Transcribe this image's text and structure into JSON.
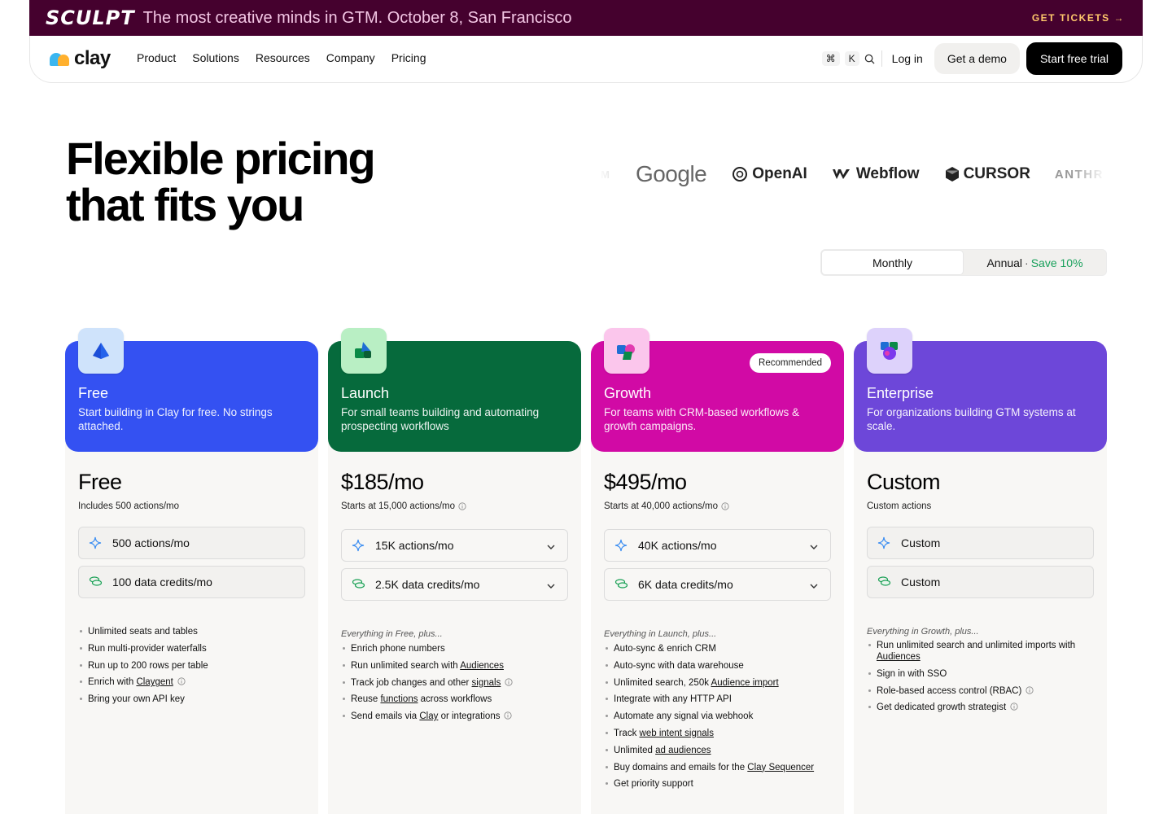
{
  "banner": {
    "brand": "SCULPT",
    "text": "The most creative minds in GTM. October 8, San Francisco",
    "cta": "GET TICKETS →"
  },
  "nav": {
    "logo": "clay",
    "links": [
      "Product",
      "Solutions",
      "Resources",
      "Company",
      "Pricing"
    ],
    "kbd_cmd": "⌘",
    "kbd_k": "K",
    "login": "Log in",
    "demo": "Get a demo",
    "trial": "Start free trial"
  },
  "hero": {
    "title_line1": "Flexible pricing",
    "title_line2": "that fits you"
  },
  "logos": {
    "partial_left": "OM",
    "google": "Google",
    "openai": "OpenAI",
    "webflow": "Webflow",
    "cursor": "CURSOR",
    "partial_right": "ANTHR"
  },
  "billing": {
    "monthly": "Monthly",
    "annual": "Annual",
    "sep": "·",
    "save": "Save 10%"
  },
  "plans": [
    {
      "name": "Free",
      "desc": "Start building in Clay for free. No strings attached.",
      "color": "#3451f2",
      "icon_bg": "#cfe3fb",
      "price": "Free",
      "price_sub": "Includes 500 actions/mo",
      "actions": "500 actions/mo",
      "credits": "100 data credits/mo",
      "intro": "",
      "features": [
        {
          "text": "Unlimited seats and tables"
        },
        {
          "text": "Run multi-provider waterfalls"
        },
        {
          "text": "Run up to 200 rows per table"
        },
        {
          "pre": "Enrich with ",
          "link": "Claygent",
          "info": true
        },
        {
          "text": "Bring your own API key"
        }
      ]
    },
    {
      "name": "Launch",
      "desc": "For small teams building and automating prospecting workflows",
      "color": "#066a3c",
      "icon_bg": "#b9efc4",
      "price": "$185/mo",
      "price_sub": "Starts at 15,000 actions/mo",
      "actions": "15K actions/mo",
      "credits": "2.5K data credits/mo",
      "intro": "Everything in Free, plus...",
      "features": [
        {
          "text": "Enrich phone numbers"
        },
        {
          "pre": "Run unlimited search with ",
          "link": "Audiences"
        },
        {
          "pre": "Track job changes and other ",
          "link": "signals",
          "info": true
        },
        {
          "pre": "Reuse ",
          "link": "functions",
          "post": " across workflows"
        },
        {
          "pre": "Send emails via ",
          "link": "Clay",
          "post": " or integrations",
          "info": true
        }
      ]
    },
    {
      "name": "Growth",
      "desc": "For teams with CRM-based workflows & growth campaigns.",
      "color": "#d10aa5",
      "icon_bg": "#fbc6ec",
      "badge": "Recommended",
      "price": "$495/mo",
      "price_sub": "Starts at 40,000 actions/mo",
      "actions": "40K actions/mo",
      "credits": "6K data credits/mo",
      "intro": "Everything in Launch, plus...",
      "features": [
        {
          "text": "Auto-sync & enrich CRM"
        },
        {
          "text": "Auto-sync with data warehouse"
        },
        {
          "pre": "Unlimited search, 250k ",
          "link": "Audience import"
        },
        {
          "text": "Integrate with any HTTP API"
        },
        {
          "text": "Automate any signal via webhook"
        },
        {
          "pre": "Track ",
          "link": "web intent signals"
        },
        {
          "pre": "Unlimited ",
          "link": "ad audiences"
        },
        {
          "pre": "Buy domains and emails for the ",
          "link": "Clay Sequencer"
        },
        {
          "text": "Get priority support"
        }
      ]
    },
    {
      "name": "Enterprise",
      "desc": "For organizations building GTM systems at scale.",
      "color": "#6d47d9",
      "icon_bg": "#ddd2fb",
      "price": "Custom",
      "price_sub": "Custom actions",
      "actions": "Custom",
      "credits": "Custom",
      "intro": "Everything in Growth, plus...",
      "features": [
        {
          "pre": "Run unlimited search and unlimited imports with ",
          "link": "Audiences"
        },
        {
          "text": "Sign in with SSO"
        },
        {
          "text": "Role-based access control (RBAC)",
          "info": true
        },
        {
          "text": "Get dedicated growth strategist",
          "info": true
        }
      ]
    }
  ],
  "accents": {
    "spark": "#3a8df2",
    "credit": "#1aa055",
    "save": "#18a05b",
    "banner": "#45012e"
  }
}
